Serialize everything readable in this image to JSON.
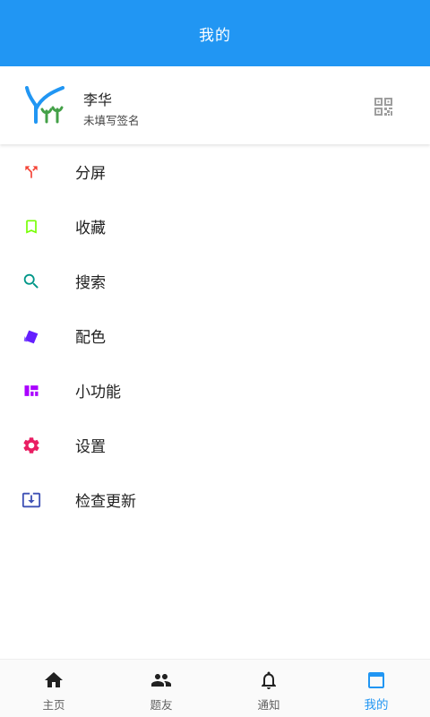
{
  "appbar": {
    "title": "我的"
  },
  "profile": {
    "name": "李华",
    "signature": "未填写签名",
    "avatar_icon": "tree-logo-icon",
    "qr_icon": "qr-code-icon"
  },
  "menu": {
    "items": [
      {
        "label": "分屏",
        "icon": "split-screen-icon",
        "color": "#f44336"
      },
      {
        "label": "收藏",
        "icon": "bookmark-icon",
        "color": "#76ff03"
      },
      {
        "label": "搜索",
        "icon": "search-icon",
        "color": "#009688"
      },
      {
        "label": "配色",
        "icon": "palette-cards-icon",
        "color": "#651fff"
      },
      {
        "label": "小功能",
        "icon": "dashboard-icon",
        "color": "#aa00ff"
      },
      {
        "label": "设置",
        "icon": "gear-icon",
        "color": "#e91e63"
      },
      {
        "label": "检查更新",
        "icon": "download-box-icon",
        "color": "#3f51b5"
      }
    ]
  },
  "bottom_nav": {
    "items": [
      {
        "label": "主页",
        "icon": "home-icon",
        "active": false
      },
      {
        "label": "题友",
        "icon": "people-icon",
        "active": false
      },
      {
        "label": "通知",
        "icon": "bell-icon",
        "active": false
      },
      {
        "label": "我的",
        "icon": "window-icon",
        "active": true
      }
    ]
  },
  "colors": {
    "primary": "#2196f3",
    "text": "#212121",
    "nav_inactive": "#616161"
  }
}
